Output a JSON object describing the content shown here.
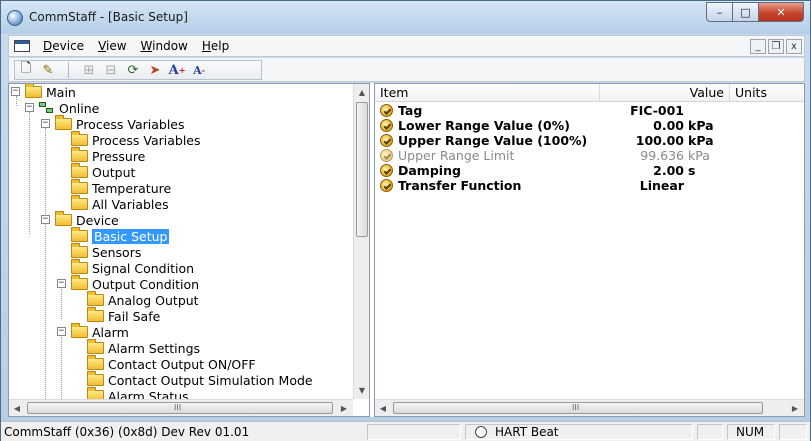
{
  "window": {
    "title": "CommStaff - [Basic Setup]",
    "controls": {
      "minimize": "–",
      "maximize": "□",
      "close": "✕"
    }
  },
  "menubar": {
    "items": [
      {
        "label": "Device",
        "underline": "D",
        "rest": "evice"
      },
      {
        "label": "View",
        "underline": "V",
        "rest": "iew"
      },
      {
        "label": "Window",
        "underline": "W",
        "rest": "indow"
      },
      {
        "label": "Help",
        "underline": "H",
        "rest": "elp"
      }
    ],
    "mdi_controls": {
      "minimize": "_",
      "restore": "❐",
      "close": "x"
    }
  },
  "toolbar": {
    "icons": [
      "new-document-icon",
      "connect-icon",
      "read-icon",
      "write-icon",
      "refresh-icon",
      "send-icon",
      "increase-font-icon",
      "decrease-font-icon"
    ],
    "glyphs": {
      "new": "🗋",
      "connect": "✎",
      "read": "⊞",
      "write": "⊟",
      "refresh": "⟳",
      "send": "➤",
      "font_up": "A",
      "font_down": "A"
    }
  },
  "tree": {
    "items": [
      {
        "label": "Main",
        "level": 0,
        "expander": "−",
        "icon": "folder"
      },
      {
        "label": "Online",
        "level": 1,
        "expander": "−",
        "icon": "network"
      },
      {
        "label": "Process Variables",
        "level": 2,
        "expander": "−",
        "icon": "folder"
      },
      {
        "label": "Process Variables",
        "level": 3,
        "icon": "folder"
      },
      {
        "label": "Pressure",
        "level": 3,
        "icon": "folder"
      },
      {
        "label": "Output",
        "level": 3,
        "icon": "folder"
      },
      {
        "label": "Temperature",
        "level": 3,
        "icon": "folder"
      },
      {
        "label": "All Variables",
        "level": 3,
        "icon": "folder"
      },
      {
        "label": "Device",
        "level": 2,
        "expander": "−",
        "icon": "folder"
      },
      {
        "label": "Basic Setup",
        "level": 3,
        "icon": "folder-open",
        "selected": true
      },
      {
        "label": "Sensors",
        "level": 3,
        "icon": "folder"
      },
      {
        "label": "Signal Condition",
        "level": 3,
        "icon": "folder"
      },
      {
        "label": "Output Condition",
        "level": 3,
        "expander": "−",
        "icon": "folder"
      },
      {
        "label": "Analog Output",
        "level": 4,
        "icon": "folder"
      },
      {
        "label": "Fail Safe",
        "level": 4,
        "icon": "folder"
      },
      {
        "label": "Alarm",
        "level": 3,
        "expander": "−",
        "icon": "folder"
      },
      {
        "label": "Alarm Settings",
        "level": 4,
        "icon": "folder"
      },
      {
        "label": "Contact Output ON/OFF",
        "level": 4,
        "icon": "folder"
      },
      {
        "label": "Contact Output Simulation Mode",
        "level": 4,
        "icon": "folder"
      },
      {
        "label": "Alarm Status",
        "level": 4,
        "icon": "folder"
      }
    ],
    "hscroll_grip": "III"
  },
  "detail": {
    "columns": {
      "item": "Item",
      "value": "Value",
      "units": "Units"
    },
    "rows": [
      {
        "item": "Tag",
        "value": "FIC-001",
        "units": "",
        "bold": true
      },
      {
        "item": "Lower Range Value (0%)",
        "value": "0.00",
        "units": "kPa",
        "bold": true
      },
      {
        "item": "Upper Range Value (100%)",
        "value": "100.00",
        "units": "kPa",
        "bold": true
      },
      {
        "item": "Upper Range Limit",
        "value": "99.636",
        "units": "kPa",
        "bold": false,
        "dim": true
      },
      {
        "item": "Damping",
        "value": "2.00",
        "units": "s",
        "bold": true
      },
      {
        "item": "Transfer Function",
        "value": "Linear",
        "units": "",
        "bold": true
      }
    ],
    "hscroll_grip": "III"
  },
  "statusbar": {
    "device_info": "CommStaff  (0x36)  (0x8d) Dev Rev 01.01",
    "hart_beat": "HART Beat",
    "num": "NUM"
  }
}
